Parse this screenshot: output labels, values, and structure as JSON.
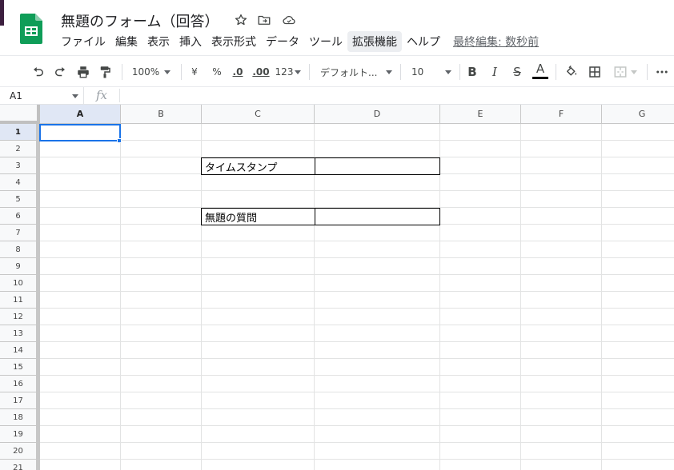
{
  "document": {
    "title": "無題のフォーム（回答）"
  },
  "menu": {
    "items": [
      "ファイル",
      "編集",
      "表示",
      "挿入",
      "表示形式",
      "データ",
      "ツール",
      "拡張機能",
      "ヘルプ"
    ],
    "active_item": "拡張機能",
    "last_edit": "最終編集: 数秒前"
  },
  "toolbar": {
    "zoom": "100%",
    "currency": "¥",
    "percent": "%",
    "decimal_decrease": ".0",
    "decimal_increase": ".00",
    "number_format": "123",
    "font": "デフォルト...",
    "font_size": "10",
    "bold": "B",
    "italic": "I",
    "strikethrough": "S",
    "text_color": "A",
    "text_color_swatch": "#000000",
    "icons": [
      "undo-icon",
      "redo-icon",
      "print-icon",
      "paint-format-icon",
      "fill-color-icon",
      "borders-icon",
      "merge-cells-icon",
      "more-icon"
    ]
  },
  "formula_bar": {
    "name_box": "A1",
    "fx_label": "fx",
    "value": ""
  },
  "grid": {
    "columns": [
      "A",
      "B",
      "C",
      "D",
      "E",
      "F",
      "G"
    ],
    "rows": [
      "1",
      "2",
      "3",
      "4",
      "5",
      "6",
      "7",
      "8",
      "9",
      "10",
      "11",
      "12",
      "13",
      "14",
      "15",
      "16",
      "17",
      "18",
      "19",
      "20",
      "21"
    ],
    "selected_cell": "A1",
    "cells": {
      "C3": "タイムスタンプ",
      "D3": "",
      "C6": "無題の質問",
      "D6": ""
    }
  },
  "colors": {
    "sheets_green": "#0f9d58",
    "selection_blue": "#1a73e8",
    "header_bg": "#f8f9fa"
  }
}
